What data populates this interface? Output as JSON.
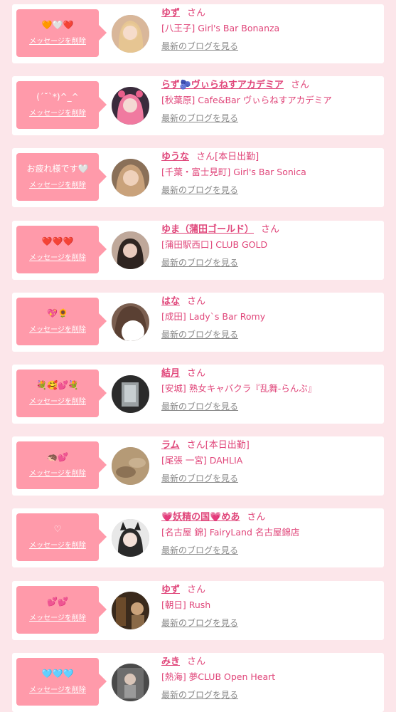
{
  "delete_label": "メッセージを削除",
  "blog_label": "最新のブログを見る",
  "san_label": "さん",
  "colors": {
    "background": "#fce6ea",
    "bubble": "#ff9aaa",
    "accent": "#e0467a",
    "link_gray": "#888888"
  },
  "entries": [
    {
      "message": "🧡🤍❤️",
      "name": "ゆず",
      "status": "",
      "shop": "[八王子] Girl's Bar Bonanza",
      "avatar_icon": "girl-photo-blonde"
    },
    {
      "message": "(ˊ˘ˋ*)^_^",
      "name": "らず🫐ヴぃらねすアカデミア",
      "status": "",
      "shop": "[秋葉原] Cafe&Bar ヴぃらねすアカデミア",
      "avatar_icon": "girl-photo-pink-hair"
    },
    {
      "message": "お疲れ様です🤍",
      "name": "ゆうな",
      "status": "[本日出勤]",
      "shop": "[千葉・富士見町] Girl's Bar Sonica",
      "avatar_icon": "girl-photo-light-hair"
    },
    {
      "message": "❤️❤️❤️",
      "name": "ゆま（蒲田ゴールド）",
      "status": "",
      "shop": "[蒲田駅西口] CLUB GOLD",
      "avatar_icon": "girl-photo-dark-hair"
    },
    {
      "message": "💖🌻",
      "name": "はな",
      "status": "",
      "shop": "[成田] Lady`s Bar Romy",
      "avatar_icon": "girl-photo-masked"
    },
    {
      "message": "💐🥰💕💐",
      "name": "結月",
      "status": "",
      "shop": "[安城] 熟女キャバクラ『乱舞-らんぶ』",
      "avatar_icon": "room-photo"
    },
    {
      "message": "🦔💕",
      "name": "ラム",
      "status": "[本日出勤]",
      "shop": "[尾張 一宮] DAHLIA",
      "avatar_icon": "blurry-photo"
    },
    {
      "message": "♡",
      "name": "💗妖精の国💗めあ",
      "status": "",
      "shop": "[名古屋 錦] FairyLand 名古屋錦店",
      "avatar_icon": "girl-photo-cat-ears"
    },
    {
      "message": "💕💕",
      "name": "ゆず",
      "status": "",
      "shop": "[朝日] Rush",
      "avatar_icon": "bar-photo"
    },
    {
      "message": "🩵🩵🩵",
      "name": "みき",
      "status": "",
      "shop": "[熱海] 夢CLUB Open Heart",
      "avatar_icon": "mirror-selfie-photo"
    }
  ]
}
